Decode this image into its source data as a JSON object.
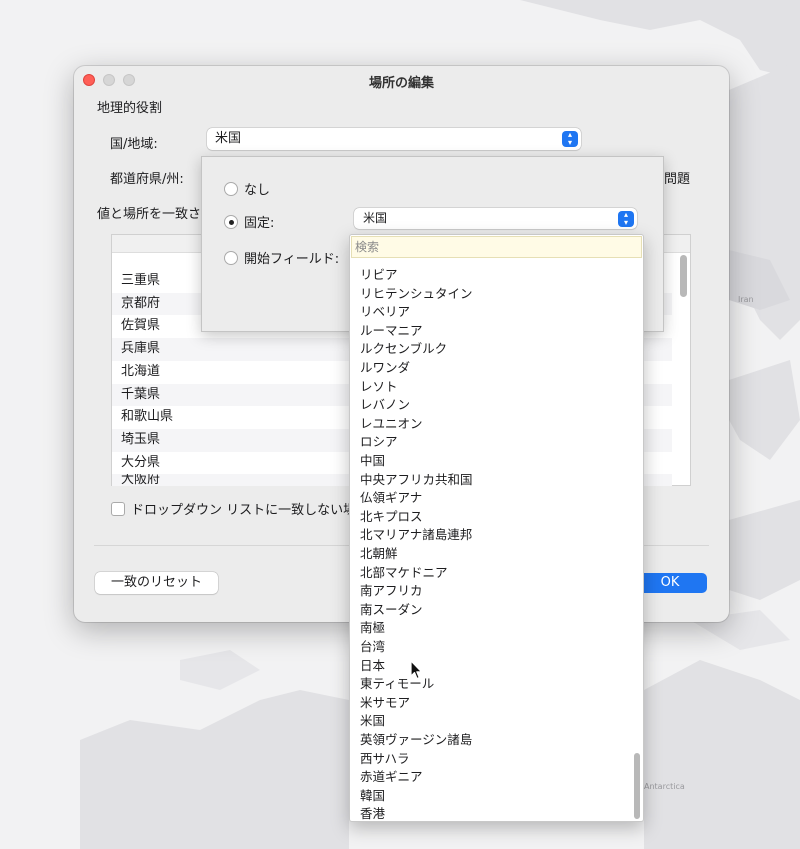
{
  "window": {
    "title": "場所の編集"
  },
  "form": {
    "section_title": "地理的役割",
    "country_label": "国/地域:",
    "country_value": "米国",
    "prefecture_label": "都道府県/州:",
    "problem_text": "問題",
    "match_label": "値と場所を一致さ",
    "rows": [
      "三重県",
      "京都府",
      "佐賀県",
      "兵庫県",
      "北海道",
      "千葉県",
      "和歌山県",
      "埼玉県",
      "大分県",
      "大阪府"
    ],
    "checkbox_label": "ドロップダウン リストに一致しない場所",
    "reset_label": "一致のリセット",
    "ok_label": "OK"
  },
  "popover": {
    "option_none": "なし",
    "option_fixed": "固定:",
    "fixed_value": "米国",
    "option_start": "開始フィールド:",
    "selected_option": "fixed"
  },
  "dropdown": {
    "search_placeholder": "検索",
    "items": [
      "リビア",
      "リヒテンシュタイン",
      "リベリア",
      "ルーマニア",
      "ルクセンブルク",
      "ルワンダ",
      "レソト",
      "レバノン",
      "レユニオン",
      "ロシア",
      "中国",
      "中央アフリカ共和国",
      "仏領ギアナ",
      "北キプロス",
      "北マリアナ諸島連邦",
      "北朝鮮",
      "北部マケドニア",
      "南アフリカ",
      "南スーダン",
      "南極",
      "台湾",
      "日本",
      "東ティモール",
      "米サモア",
      "米国",
      "英領ヴァージン諸島",
      "西サハラ",
      "赤道ギニア",
      "韓国",
      "香港"
    ]
  },
  "map": {
    "label_iran": "Iran",
    "label_antarctica": "Antarctica"
  },
  "colors": {
    "accent": "#1f76f2",
    "close": "#ff5f57"
  }
}
